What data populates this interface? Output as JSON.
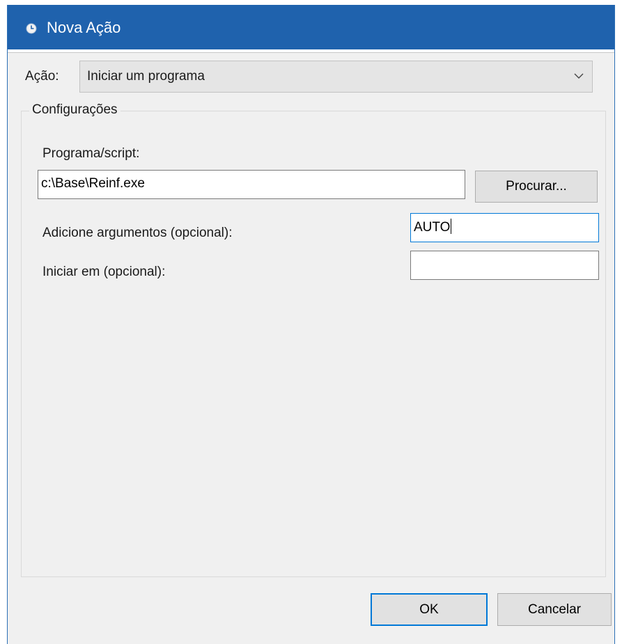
{
  "window": {
    "title": "Nova Ação",
    "title_icon": "clock-icon",
    "colors": {
      "titlebar": "#1f62ad",
      "background": "#f0f0f0",
      "focus_accent": "#0078d7"
    }
  },
  "action": {
    "label": "Ação:",
    "selected_value": "Iniciar um programa",
    "dropdown_icon": "chevron-down-icon"
  },
  "settings": {
    "group_title": "Configurações",
    "program_label": "Programa/script:",
    "program_value": "c:\\Base\\Reinf.exe",
    "browse_button": "Procurar...",
    "arguments_label": "Adicione argumentos (opcional):",
    "arguments_value": "AUTO",
    "start_in_label": "Iniciar em (opcional):",
    "start_in_value": ""
  },
  "footer": {
    "ok_label": "OK",
    "cancel_label": "Cancelar"
  }
}
